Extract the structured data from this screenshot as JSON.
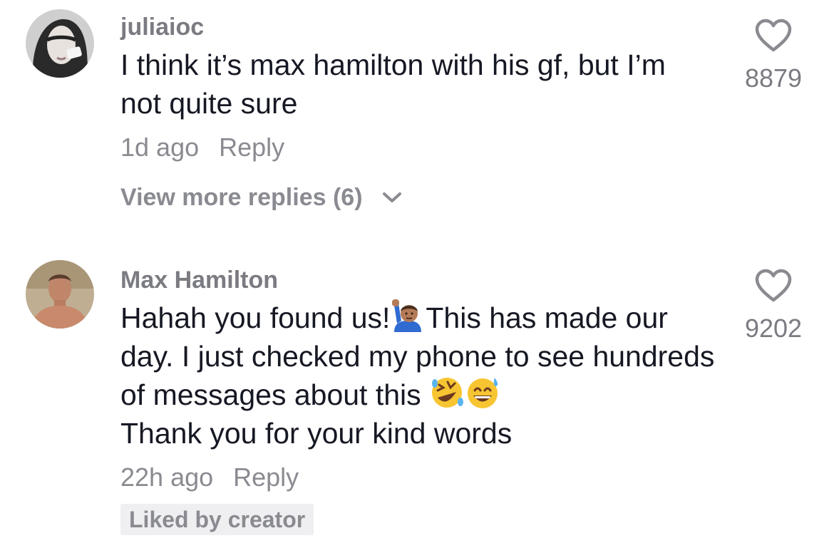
{
  "comments": [
    {
      "username": "juliaioc",
      "text": "I think it’s max hamilton with his gf, but I’m not quite sure",
      "time": "1d ago",
      "reply_label": "Reply",
      "view_more_label": "View more replies (6)",
      "likes": "8879",
      "avatar_icon": "avatar-juliaioc"
    },
    {
      "username": "Max Hamilton",
      "text_part1": "Hahah you found us!",
      "text_part2": "This has made our day. I just checked my phone to see hundreds of messages about this",
      "text_part3": "Thank you for your kind words",
      "time": "22h ago",
      "reply_label": "Reply",
      "badge": "Liked by creator",
      "likes": "9202",
      "avatar_icon": "avatar-max-hamilton",
      "emojis": [
        "person-raising-hand-emoji",
        "rolling-on-floor-laughing-emoji",
        "grinning-face-with-sweat-emoji"
      ]
    }
  ],
  "colors": {
    "text": "#161823",
    "username_gray": "#7b7c82",
    "meta_gray": "#8a8b91",
    "badge_bg": "#efeff1"
  }
}
